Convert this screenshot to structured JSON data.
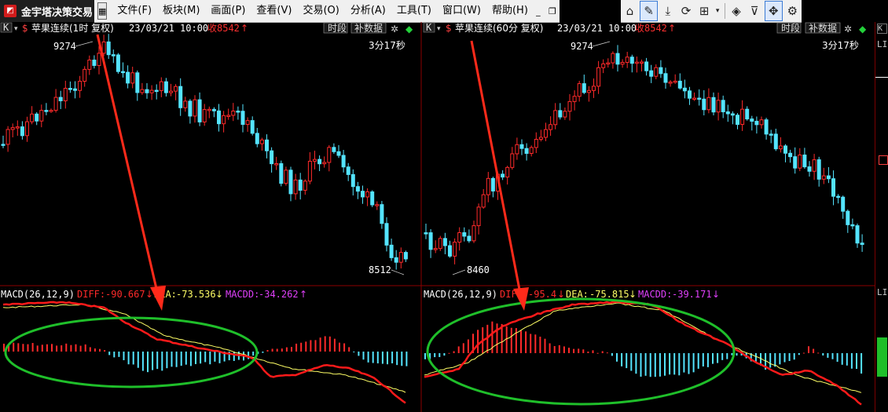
{
  "app": {
    "title": "金宇塔决策交易"
  },
  "menu": {
    "items": [
      "文件(F)",
      "板块(M)",
      "画面(P)",
      "查看(V)",
      "交易(O)",
      "分析(A)",
      "工具(T)",
      "窗口(W)",
      "帮助(H)"
    ],
    "window_controls": [
      "_",
      "ᵇ",
      "×"
    ]
  },
  "toolbar": {
    "icons": [
      "home-icon",
      "draw-icon",
      "download-icon",
      "sync-icon",
      "grid-icon",
      "dropdown-icon",
      "signal-icon",
      "filter-icon",
      "move-icon",
      "settings-icon"
    ]
  },
  "panels": [
    {
      "k_label": "K",
      "dollar": "$",
      "title": "苹果连续(1时 复权)",
      "datetime": "23/03/21 10:00",
      "close_label": "收",
      "close_value": "8542",
      "close_arrow": "↑",
      "btn_period": "时段",
      "btn_supplement": "补数据",
      "countdown": "3分17秒",
      "high_label": "9274",
      "low_label": "8512",
      "macd": {
        "params": "MACD(26,12,9)",
        "diff_label": "DIFF:",
        "diff": "-90.667",
        "diff_arrow": "↓",
        "dea_label": "DEA:",
        "dea": "-73.536",
        "dea_arrow": "↓",
        "macdd_label": "MACDD:",
        "macdd": "-34.262",
        "macdd_arrow": "↑"
      }
    },
    {
      "k_label": "K",
      "dollar": "$",
      "title": "苹果连续(60分 复权)",
      "datetime": "23/03/21 10:00",
      "close_label": "收",
      "close_value": "8542",
      "close_arrow": "↑",
      "btn_period": "时段",
      "btn_supplement": "补数据",
      "countdown": "3分17秒",
      "high_label": "9274",
      "low_label": "8460",
      "macd": {
        "params": "MACD(26,12,9)",
        "diff_label": "DIFF:",
        "diff": "-95.4",
        "diff_arrow": "↓",
        "dea_label": "DEA:",
        "dea": "-75.815",
        "dea_arrow": "↓",
        "macdd_label": "MACDD:",
        "macdd": "-39.171",
        "macdd_arrow": "↓"
      }
    }
  ],
  "right_strip": {
    "k_label": "K",
    "label_top": "LI",
    "label_bottom": "LI"
  },
  "colors": {
    "up": "#ff2a2a",
    "down": "#54e4ff",
    "dea_line": "#ffff66",
    "diff_line": "#ff1a1a",
    "macdd_text": "#e040fb",
    "separator": "#8b0000",
    "ellipse": "#1fbf2a",
    "arrow": "#ff2a1a"
  }
}
